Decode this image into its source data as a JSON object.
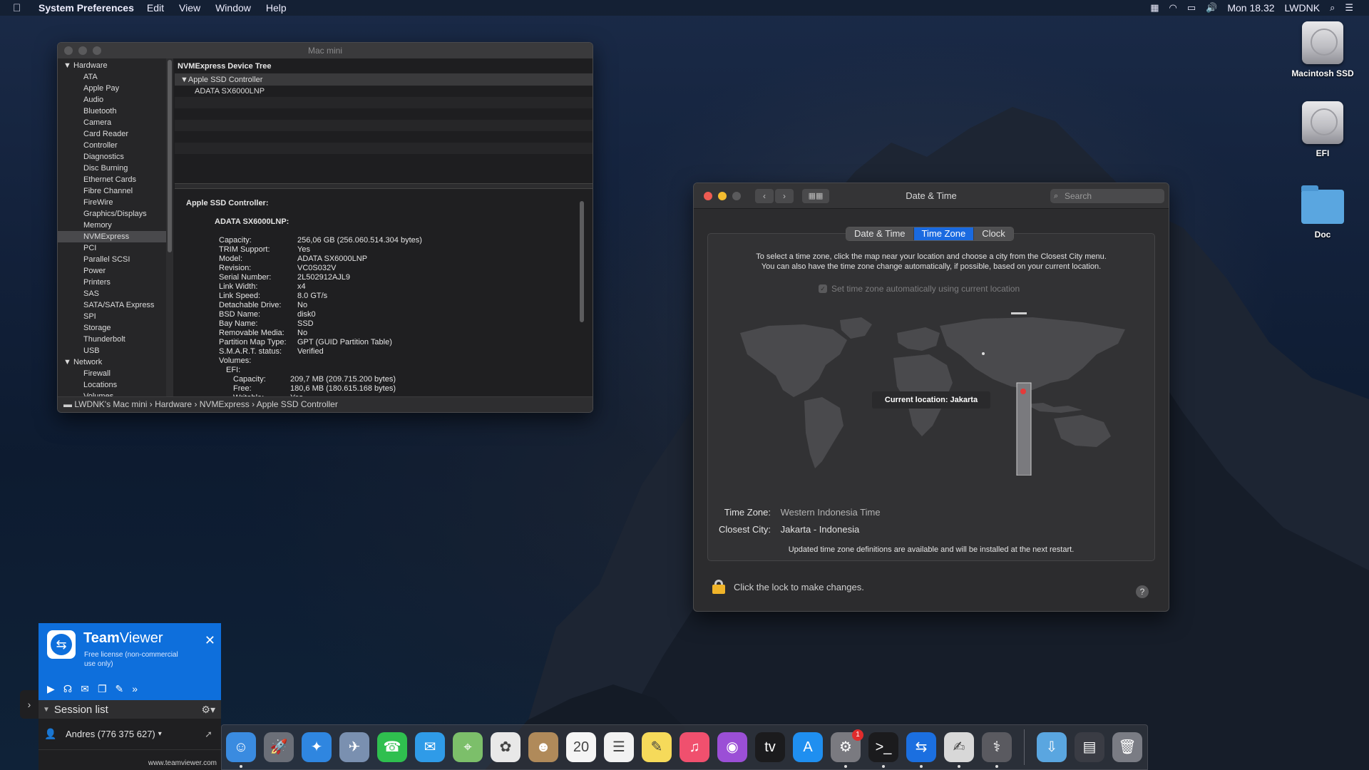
{
  "menubar": {
    "app_name": "System Preferences",
    "menus": [
      "Edit",
      "View",
      "Window",
      "Help"
    ],
    "clock": "Mon 18.32",
    "user": "LWDNK"
  },
  "desktop_icons": [
    {
      "label": "Macintosh SSD",
      "icon": "hard-disk-icon"
    },
    {
      "label": "EFI",
      "icon": "hard-disk-icon"
    },
    {
      "label": "Doc",
      "icon": "folder-icon"
    }
  ],
  "sysinfo": {
    "title": "Mac mini",
    "sidebar": [
      {
        "label": "Hardware",
        "group": true
      },
      {
        "label": "ATA"
      },
      {
        "label": "Apple Pay"
      },
      {
        "label": "Audio"
      },
      {
        "label": "Bluetooth"
      },
      {
        "label": "Camera"
      },
      {
        "label": "Card Reader"
      },
      {
        "label": "Controller"
      },
      {
        "label": "Diagnostics"
      },
      {
        "label": "Disc Burning"
      },
      {
        "label": "Ethernet Cards"
      },
      {
        "label": "Fibre Channel"
      },
      {
        "label": "FireWire"
      },
      {
        "label": "Graphics/Displays"
      },
      {
        "label": "Memory"
      },
      {
        "label": "NVMExpress",
        "selected": true
      },
      {
        "label": "PCI"
      },
      {
        "label": "Parallel SCSI"
      },
      {
        "label": "Power"
      },
      {
        "label": "Printers"
      },
      {
        "label": "SAS"
      },
      {
        "label": "SATA/SATA Express"
      },
      {
        "label": "SPI"
      },
      {
        "label": "Storage"
      },
      {
        "label": "Thunderbolt"
      },
      {
        "label": "USB"
      },
      {
        "label": "Network",
        "group": true
      },
      {
        "label": "Firewall"
      },
      {
        "label": "Locations"
      },
      {
        "label": "Volumes"
      }
    ],
    "tree_header": "NVMExpress Device Tree",
    "tree_rows": [
      "Apple SSD Controller",
      "ADATA SX6000LNP",
      "",
      "",
      "",
      "",
      "",
      ""
    ],
    "detail_title": "Apple SSD Controller:",
    "detail_device": "ADATA SX6000LNP:",
    "detail_props": [
      {
        "k": "Capacity:",
        "v": "256,06 GB (256.060.514.304 bytes)"
      },
      {
        "k": "TRIM Support:",
        "v": "Yes"
      },
      {
        "k": "Model:",
        "v": "ADATA SX6000LNP"
      },
      {
        "k": "Revision:",
        "v": "VC0S032V"
      },
      {
        "k": "Serial Number:",
        "v": "2L502912AJL9"
      },
      {
        "k": "Link Width:",
        "v": "x4"
      },
      {
        "k": "Link Speed:",
        "v": "8.0 GT/s"
      },
      {
        "k": "Detachable Drive:",
        "v": "No"
      },
      {
        "k": "BSD Name:",
        "v": "disk0"
      },
      {
        "k": "Bay Name:",
        "v": "SSD"
      },
      {
        "k": "Removable Media:",
        "v": "No"
      },
      {
        "k": "Partition Map Type:",
        "v": "GPT (GUID Partition Table)"
      },
      {
        "k": "S.M.A.R.T. status:",
        "v": "Verified"
      },
      {
        "k": "Volumes:",
        "v": ""
      }
    ],
    "efi_label": "EFI:",
    "efi_props": [
      {
        "k": "Capacity:",
        "v": "209,7 MB (209.715.200 bytes)"
      },
      {
        "k": "Free:",
        "v": "180,6 MB (180.615.168 bytes)"
      },
      {
        "k": "Writable:",
        "v": "Yes"
      }
    ],
    "pathbar": "LWDNK's Mac mini › Hardware › NVMExpress › Apple SSD Controller"
  },
  "datetime": {
    "title": "Date & Time",
    "search_placeholder": "Search",
    "tabs": [
      {
        "label": "Date & Time",
        "active": false
      },
      {
        "label": "Time Zone",
        "active": true
      },
      {
        "label": "Clock",
        "active": false
      }
    ],
    "description_line1": "To select a time zone, click the map near your location and choose a city from the Closest City menu.",
    "description_line2": "You can also have the time zone change automatically, if possible, based on your current location.",
    "auto_label": "Set time zone automatically using current location",
    "auto_checked": true,
    "current_location": "Current location: Jakarta",
    "time_zone_label": "Time Zone:",
    "time_zone_value": "Western Indonesia Time",
    "closest_city_label": "Closest City:",
    "closest_city_value": "Jakarta - Indonesia",
    "notice": "Updated time zone definitions are available and will be installed at the next restart.",
    "lock_text": "Click the lock to make changes.",
    "help": "?"
  },
  "teamviewer": {
    "brand_bold": "Team",
    "brand_rest": "Viewer",
    "license": "Free license (non-commercial use only)",
    "session_list": "Session list",
    "user": "Andres (776 375 627)",
    "url": "www.teamviewer.com"
  },
  "dock": {
    "apps": [
      {
        "name": "Finder",
        "icon": "finder-icon",
        "color": "#3a8be0",
        "glyph": "☺",
        "running": true
      },
      {
        "name": "Launchpad",
        "icon": "launchpad-icon",
        "color": "#6b6f78",
        "glyph": "🚀"
      },
      {
        "name": "Safari",
        "icon": "safari-icon",
        "color": "#2f86e0",
        "glyph": "✦"
      },
      {
        "name": "Preview",
        "icon": "preview-icon",
        "color": "#7a90b0",
        "glyph": "✈"
      },
      {
        "name": "FaceTime",
        "icon": "facetime-icon",
        "color": "#2fbf4f",
        "glyph": "☎"
      },
      {
        "name": "Messages",
        "icon": "messages-icon",
        "color": "#2f9be8",
        "glyph": "✉"
      },
      {
        "name": "Maps",
        "icon": "maps-icon",
        "color": "#7cbf6a",
        "glyph": "⌖"
      },
      {
        "name": "Photos",
        "icon": "photos-icon",
        "color": "#e8e8e8",
        "glyph": "✿"
      },
      {
        "name": "Contacts",
        "icon": "contacts-icon",
        "color": "#b08a5a",
        "glyph": "☻"
      },
      {
        "name": "Calendar",
        "icon": "calendar-icon",
        "color": "#f5f5f5",
        "glyph": "20"
      },
      {
        "name": "Reminders",
        "icon": "reminders-icon",
        "color": "#f2f2f2",
        "glyph": "☰"
      },
      {
        "name": "Notes",
        "icon": "notes-icon",
        "color": "#f6da5a",
        "glyph": "✎"
      },
      {
        "name": "Music",
        "icon": "music-icon",
        "color": "#f0506e",
        "glyph": "♫"
      },
      {
        "name": "Podcasts",
        "icon": "podcasts-icon",
        "color": "#9b4fd6",
        "glyph": "◉"
      },
      {
        "name": "TV",
        "icon": "tv-icon",
        "color": "#1b1b1d",
        "glyph": "tv"
      },
      {
        "name": "App Store",
        "icon": "app-store-icon",
        "color": "#1f8ff0",
        "glyph": "A"
      },
      {
        "name": "System Preferences",
        "icon": "system-preferences-icon",
        "color": "#7a7a80",
        "glyph": "⚙",
        "badge": "1",
        "running": true
      },
      {
        "name": "Terminal",
        "icon": "terminal-icon",
        "color": "#1b1b1d",
        "glyph": ">_",
        "running": true
      },
      {
        "name": "TeamViewer",
        "icon": "teamviewer-icon",
        "color": "#1b6fe0",
        "glyph": "⇆",
        "running": true
      },
      {
        "name": "Script Editor",
        "icon": "script-editor-icon",
        "color": "#d8d8d8",
        "glyph": "✍",
        "running": true
      },
      {
        "name": "System Information",
        "icon": "system-information-icon",
        "color": "#5a5a60",
        "glyph": "⚕",
        "running": true
      }
    ],
    "stacks": [
      {
        "name": "Downloads",
        "icon": "downloads-folder-icon",
        "color": "#5aa6e0",
        "glyph": "⇩"
      },
      {
        "name": "Recent",
        "icon": "recent-stack-icon",
        "color": "#3a3c44",
        "glyph": "▤"
      },
      {
        "name": "Trash",
        "icon": "trash-icon",
        "color": "#7a7c84",
        "glyph": "🗑"
      }
    ]
  }
}
